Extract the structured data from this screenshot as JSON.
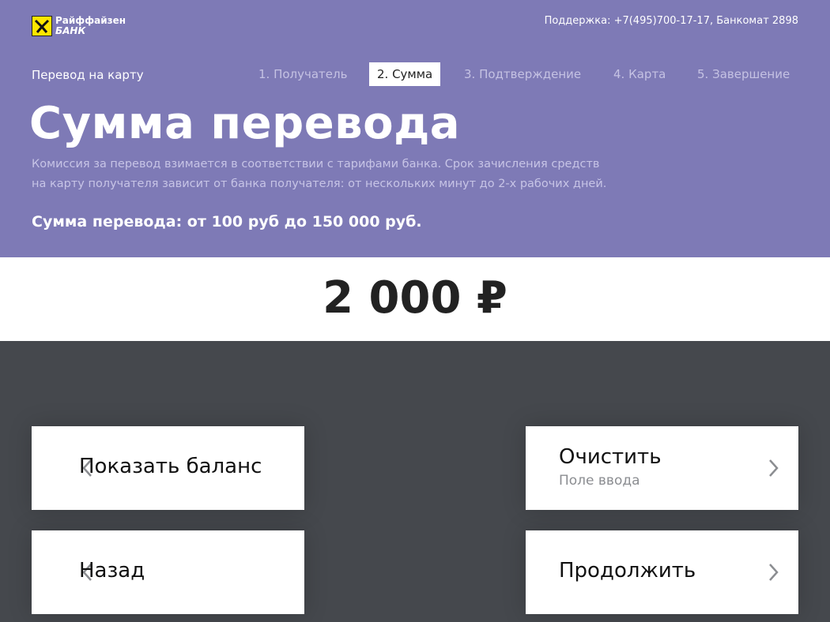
{
  "header": {
    "logo": {
      "line1": "Райффайзен",
      "line2": "БАНК"
    },
    "support": "Поддержка: +7(495)700-17-17, Банкомат 2898",
    "breadcrumb": "Перевод на карту",
    "steps": [
      {
        "label": "1. Получатель",
        "active": false
      },
      {
        "label": "2. Сумма",
        "active": true
      },
      {
        "label": "3. Подтверждение",
        "active": false
      },
      {
        "label": "4. Карта",
        "active": false
      },
      {
        "label": "5. Завершение",
        "active": false
      }
    ],
    "title": "Сумма перевода",
    "description_line1": "Комиссия за перевод взимается в соответствии с тарифами банка. Срок зачисления средств",
    "description_line2": "на карту получателя зависит от банка получателя: от нескольких минут до 2-х рабочих дней.",
    "limits": "Сумма перевода: от 100 руб до 150 000 руб."
  },
  "amount": {
    "value": "2 000 ₽"
  },
  "buttons": {
    "show_balance": "Показать баланс",
    "back": "Назад",
    "clear": "Очистить",
    "clear_sub": "Поле ввода",
    "continue": "Продолжить"
  },
  "colors": {
    "header_bg": "#7e7ab6",
    "keypad_bg": "#45484d",
    "logo_yellow": "#fee600",
    "active_step_bg": "#ffffff"
  }
}
